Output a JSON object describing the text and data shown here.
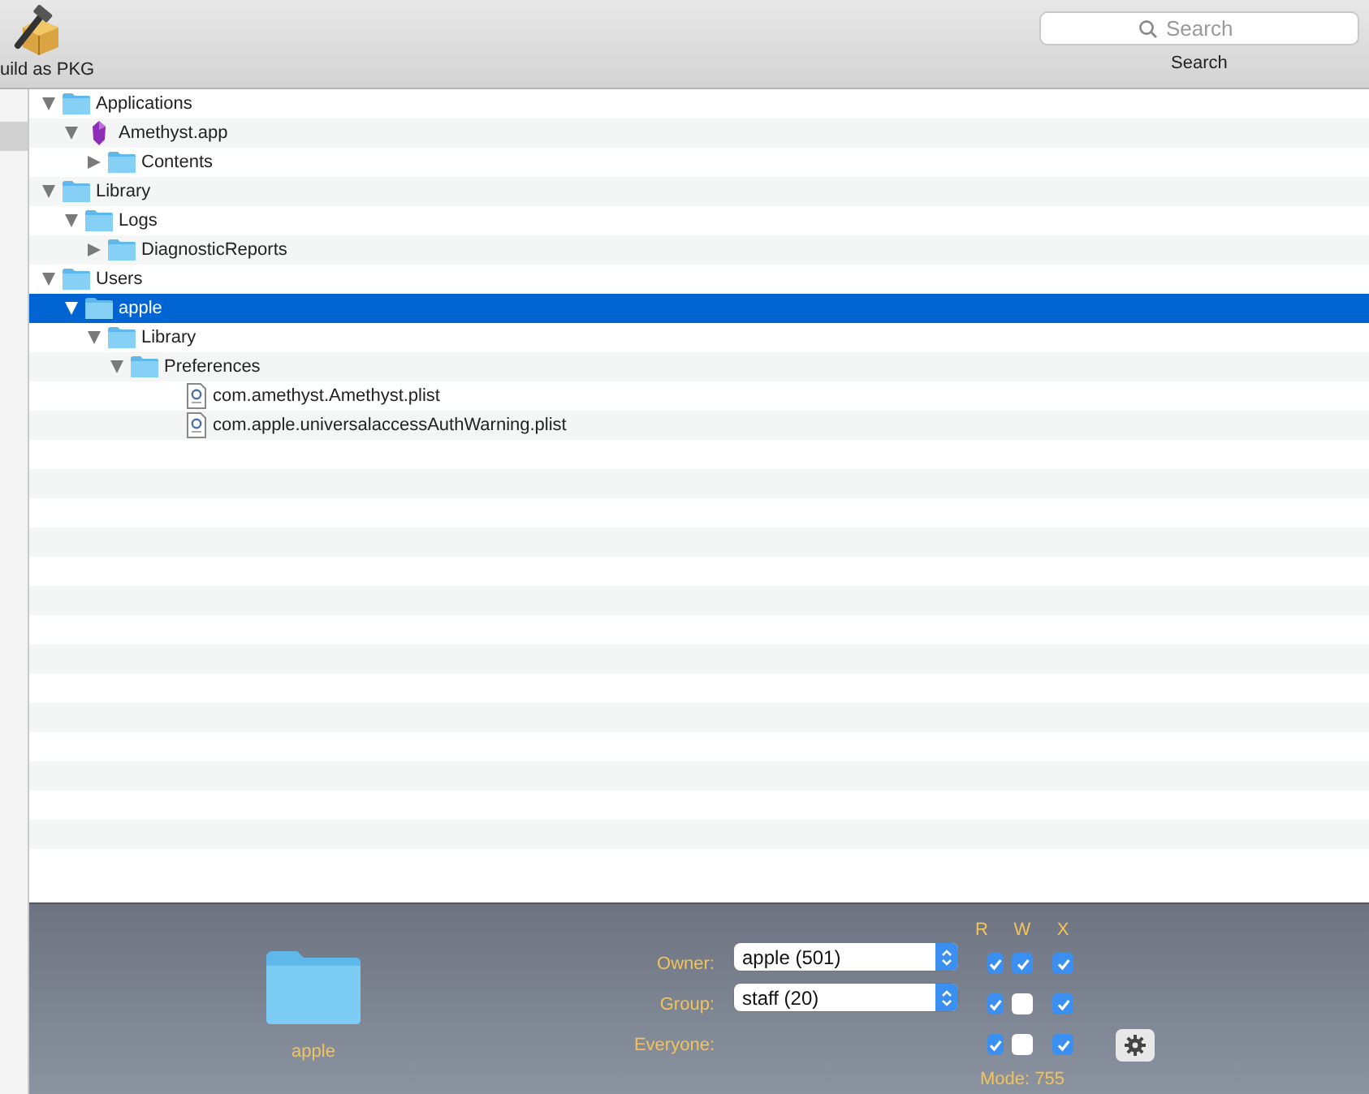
{
  "toolbar": {
    "build_button": {
      "label": "uild as PKG"
    },
    "search": {
      "placeholder": "Search",
      "label": "Search"
    }
  },
  "tree": [
    {
      "name": "Applications",
      "kind": "folder",
      "expanded": true,
      "selected": false,
      "children": [
        {
          "name": "Amethyst.app",
          "kind": "app",
          "expanded": true,
          "selected": false,
          "children": [
            {
              "name": "Contents",
              "kind": "folder",
              "expanded": false,
              "selected": false
            }
          ]
        }
      ]
    },
    {
      "name": "Library",
      "kind": "folder",
      "expanded": true,
      "selected": false,
      "children": [
        {
          "name": "Logs",
          "kind": "folder",
          "expanded": true,
          "selected": false,
          "children": [
            {
              "name": "DiagnosticReports",
              "kind": "folder",
              "expanded": false,
              "selected": false
            }
          ]
        }
      ]
    },
    {
      "name": "Users",
      "kind": "folder",
      "expanded": true,
      "selected": false,
      "children": [
        {
          "name": "apple",
          "kind": "folder",
          "expanded": true,
          "selected": true,
          "children": [
            {
              "name": "Library",
              "kind": "folder",
              "expanded": true,
              "selected": false,
              "children": [
                {
                  "name": "Preferences",
                  "kind": "folder",
                  "expanded": true,
                  "selected": false,
                  "children": [
                    {
                      "name": "com.amethyst.Amethyst.plist",
                      "kind": "file",
                      "selected": false
                    },
                    {
                      "name": "com.apple.universalaccessAuthWarning.plist",
                      "kind": "file",
                      "selected": false
                    }
                  ]
                }
              ]
            }
          ]
        }
      ]
    }
  ],
  "inspector": {
    "item_name": "apple",
    "columns": [
      "R",
      "W",
      "X"
    ],
    "permissions": [
      {
        "label": "Owner:",
        "value": "apple (501)",
        "read": true,
        "write": true,
        "execute": true
      },
      {
        "label": "Group:",
        "value": "staff (20)",
        "read": true,
        "write": false,
        "execute": true
      },
      {
        "label": "Everyone:",
        "read": true,
        "write": false,
        "execute": true
      }
    ],
    "mode": "Mode: 755"
  }
}
